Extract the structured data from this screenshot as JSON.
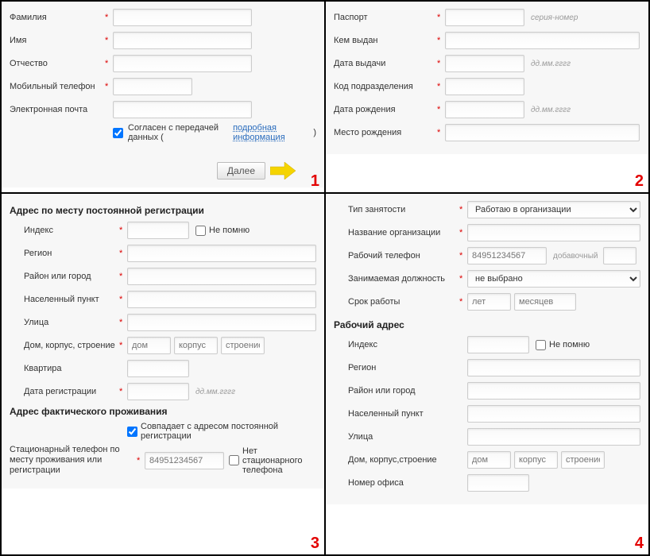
{
  "step1": {
    "fields": {
      "lastname": "Фамилия",
      "firstname": "Имя",
      "patronymic": "Отчество",
      "mobile": "Мобильный телефон",
      "email": "Электронная почта"
    },
    "consent_label": "Согласен с передачей данных (",
    "consent_link": "подробная информация",
    "consent_close": ")",
    "next": "Далее"
  },
  "step2": {
    "fields": {
      "passport": "Паспорт",
      "passport_hint": "серия-номер",
      "issued_by": "Кем выдан",
      "issue_date": "Дата выдачи",
      "dept_code": "Код подразделения",
      "birth_date": "Дата рождения",
      "birth_place": "Место рождения",
      "date_hint": "дд.мм.гггг"
    }
  },
  "step3": {
    "reg_header": "Адрес по месту постоянной регистрации",
    "fact_header": "Адрес фактического проживания",
    "fields": {
      "index": "Индекс",
      "not_remember": "Не помню",
      "region": "Регион",
      "district_city": "Район или город",
      "locality": "Населенный пункт",
      "street": "Улица",
      "house_block": "Дом, корпус, строение",
      "house_ph": "дом",
      "block_ph": "корпус",
      "building_ph": "строение",
      "apartment": "Квартира",
      "reg_date": "Дата регистрации",
      "date_hint": "дд.мм.гггг",
      "same_cb": "Совпадает с адресом постоянной регистрации",
      "landline_lbl": "Стационарный телефон по месту проживания или регистрации",
      "landline_ph": "84951234567",
      "no_landline": "Нет стационарного телефона"
    }
  },
  "step4": {
    "work_header": "Рабочий адрес",
    "fields": {
      "employment_type": "Тип занятости",
      "employment_sel": "Работаю в организации",
      "org_name": "Название организации",
      "work_phone": "Рабочий телефон",
      "work_phone_ph": "84951234567",
      "ext_lbl": "добавочный",
      "position": "Занимаемая должность",
      "position_sel": "не выбрано",
      "tenure": "Срок работы",
      "years_ph": "лет",
      "months_ph": "месяцев",
      "index": "Индекс",
      "not_remember": "Не помню",
      "region": "Регион",
      "district_city": "Район или город",
      "locality": "Населенный пункт",
      "street": "Улица",
      "house_block": "Дом, корпус,строение",
      "house_ph": "дом",
      "block_ph": "корпус",
      "building_ph": "строение",
      "office": "Номер офиса"
    }
  },
  "nums": {
    "n1": "1",
    "n2": "2",
    "n3": "3",
    "n4": "4"
  }
}
